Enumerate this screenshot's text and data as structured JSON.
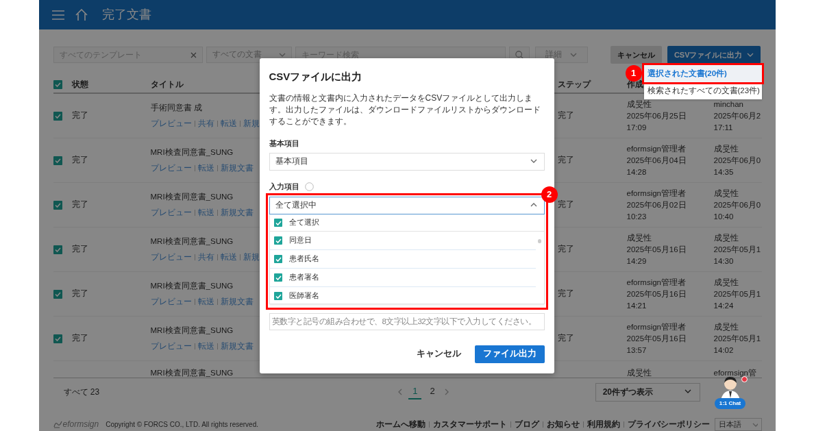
{
  "header": {
    "title": "完了文書"
  },
  "filters": {
    "template": {
      "placeholder": "すべてのテンプレート"
    },
    "document_type": {
      "value": "すべての文書"
    },
    "keyword": {
      "placeholder": "キーワード検索"
    },
    "detail": {
      "value": "詳細"
    }
  },
  "toolbar": {
    "cancel": "キャンセル",
    "export": "CSVファイルに出力",
    "export_menu": [
      {
        "label": "選択された文書(20件)",
        "selected": true
      },
      {
        "label": "検索されたすべての文書(23件)",
        "selected": false
      }
    ]
  },
  "table": {
    "all_checked": true,
    "columns": [
      "状態",
      "タイトル",
      "ステップ",
      "作成"
    ],
    "rows": [
      {
        "checked": true,
        "status": "完了",
        "title": "手術同意書 成",
        "actions": [
          "プレビュー",
          "共有",
          "転送",
          "新規"
        ],
        "step": "完了",
        "creator": [
          "成旻性",
          "2025年06月25日",
          "17:09"
        ],
        "column_6": [
          "minchan",
          "2025年06月2",
          "17:11"
        ]
      },
      {
        "checked": true,
        "status": "完了",
        "title": "MRI検査同意書_SUNG",
        "actions": [
          "プレビュー",
          "転送",
          "新規文書"
        ],
        "step": "完了",
        "creator": [
          "eformsign管理者",
          "2025年06月04日",
          "14:28"
        ],
        "column_6": [
          "成旻性",
          "2025年06月0",
          "14:35"
        ]
      },
      {
        "checked": true,
        "status": "完了",
        "title": "MRI検査同意書_SUNG",
        "actions": [
          "プレビュー",
          "転送",
          "新規文書"
        ],
        "step": "完了",
        "creator": [
          "eformsign管理者",
          "2025年06月02日",
          "10:23"
        ],
        "column_6": [
          "成旻性",
          "2025年06月0",
          "10:40"
        ]
      },
      {
        "checked": true,
        "status": "完了",
        "title": "MRI検査同意書_SUNG",
        "actions": [
          "プレビュー",
          "共有",
          "転送",
          "新規"
        ],
        "step": "完了",
        "creator": [
          "成旻性",
          "2025年05月16日",
          "14:29"
        ],
        "column_6": [
          "成旻性",
          "2025年05月1",
          "14:30"
        ]
      },
      {
        "checked": true,
        "status": "完了",
        "title": "MRI検査同意書_SUNG",
        "actions": [
          "プレビュー",
          "転送",
          "新規文書"
        ],
        "step": "完了",
        "creator": [
          "eformsign管理者",
          "2025年05月16日",
          "14:21"
        ],
        "column_6": [
          "成旻性",
          "2025年05月1",
          "14:24"
        ]
      },
      {
        "checked": true,
        "status": "完了",
        "title": "MRI検査同意書_SUNG",
        "actions": [
          "プレビュー",
          "転送",
          "新規文書"
        ],
        "step": "完了",
        "creator": [
          "eformsign管理者",
          "2025年05月16日",
          "13:57"
        ],
        "column_6": [
          "成旻性",
          "2025年05月1",
          "14:02"
        ]
      },
      {
        "title": "MRI検査同意書_SUNG",
        "creator": [
          "成旻性"
        ],
        "column_6": [
          "eformsign管"
        ]
      }
    ]
  },
  "pagination": {
    "total": "すべて 23",
    "pages": [
      {
        "label": "1",
        "selected": true
      },
      {
        "label": "2",
        "selected": false
      }
    ],
    "page_size": "20件ずつ表示"
  },
  "chat": {
    "label": "1:1 Chat",
    "unread": true
  },
  "footer": {
    "logo": "eformsign",
    "copyright": "Copyright © FORCS CO., LTD. All rights reserved.",
    "links": [
      "ホームへ移動",
      "カスタマーサポート",
      "ブログ",
      "お知らせ",
      "利用規約",
      "プライバシーポリシー"
    ],
    "language": "日本語"
  },
  "dialog": {
    "title": "CSVファイルに出力",
    "description": [
      "文書の情報と文書内に入力されたデータをCSVファイルとして出力します。",
      "出力したファイルは、ダウンロードファイルリストからダウンロードすることができます。"
    ],
    "basic_label": "基本項目",
    "basic_value": "基本項目",
    "input_label": "入力項目",
    "input_value": "全て選択中",
    "expanded": true,
    "options": [
      {
        "label": "全て選択",
        "checked": true
      },
      {
        "label": "同意日",
        "checked": true
      },
      {
        "label": "患者氏名",
        "checked": true
      },
      {
        "label": "患者署名",
        "checked": true
      },
      {
        "label": "医師署名",
        "checked": true
      }
    ],
    "password": {
      "placeholder": "英数字と記号の組み合わせで、8文字以上32文字以下で入力してください。"
    },
    "cancel": "キャンセル",
    "submit": "ファイル出力"
  },
  "annotations": [
    {
      "number": "1"
    },
    {
      "number": "2"
    }
  ]
}
